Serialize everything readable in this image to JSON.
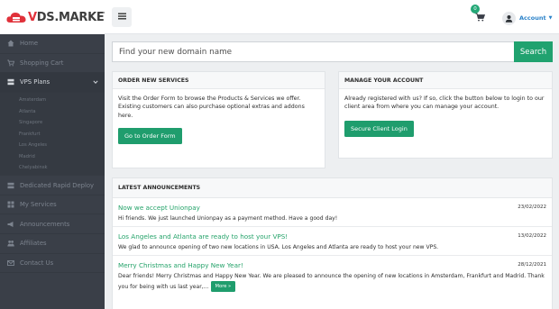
{
  "brand": {
    "logo_prefix": "V",
    "logo_text": "DS.MARKET"
  },
  "sidebar": {
    "items": [
      {
        "label": "Home",
        "icon": "home-icon"
      },
      {
        "label": "Shopping Cart",
        "icon": "cart-icon"
      },
      {
        "label": "VPS Plans",
        "icon": "server-icon"
      },
      {
        "label": "Dedicated Rapid Deploy",
        "icon": "server-icon"
      },
      {
        "label": "My Services",
        "icon": "grid-icon"
      },
      {
        "label": "Announcements",
        "icon": "megaphone-icon"
      },
      {
        "label": "Affiliates",
        "icon": "users-icon"
      },
      {
        "label": "Contact Us",
        "icon": "envelope-icon"
      }
    ],
    "vps_sub": [
      "Amsterdam",
      "Atlanta",
      "Singapore",
      "Frankfurt",
      "Los Angeles",
      "Madrid",
      "Chelyabinsk"
    ]
  },
  "topbar": {
    "cart_count": "0",
    "account_label": "Account"
  },
  "search": {
    "placeholder": "Find your new domain name",
    "button_label": "Search"
  },
  "order": {
    "title": "ORDER NEW SERVICES",
    "text": "Visit the Order Form to browse the Products & Services we offer. Existing customers can also purchase optional extras and addons here.",
    "button": "Go to Order Form"
  },
  "manage": {
    "title": "MANAGE YOUR ACCOUNT",
    "text": "Already registered with us? If so, click the button below to login to our client area from where you can manage your account.",
    "button": "Secure Client Login"
  },
  "announcements": {
    "title": "LATEST ANNOUNCEMENTS",
    "items": [
      {
        "title": "Now we accept Unionpay",
        "date": "23/02/2022",
        "body": "Hi friends.  We just launched Unionpay as a payment method.  Have a good day!"
      },
      {
        "title": "Los Angeles and Atlanta are ready to host your VPS!",
        "date": "13/02/2022",
        "body": "We glad to announce opening of two new locations in USA. Los Angeles and Atlanta are ready to host your new VPS."
      },
      {
        "title": "Merry Christmas and Happy New Year!",
        "date": "28/12/2021",
        "body": "Dear friends!  Merry Christmas and Happy New Year. We are pleased to announce the opening of new locations in Amsterdam, Frankfurt and Madrid.   Thank you for being with us last year,...",
        "more": "More »"
      }
    ]
  },
  "colors": {
    "accent": "#20a26f",
    "link": "#2a82c9",
    "sidebar_bg": "#3a3f48",
    "logo_red": "#e0313a"
  }
}
